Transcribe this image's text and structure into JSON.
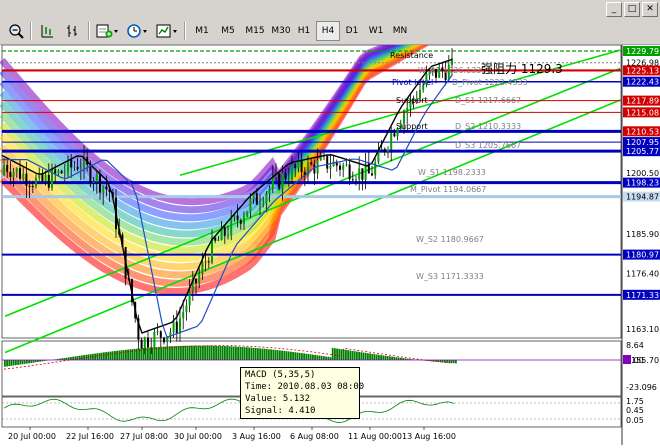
{
  "window": {
    "controls": [
      "_",
      "□",
      "✕"
    ]
  },
  "toolbar": {
    "periods": [
      "M1",
      "M5",
      "M15",
      "M30",
      "H1",
      "H4",
      "D1",
      "W1",
      "MN"
    ],
    "active_period": "H4"
  },
  "price_scale": [
    "1229.79",
    "1226.98",
    "1225.13",
    "1222.43",
    "1217.89",
    "1215.08",
    "1210.53",
    "1207.95",
    "1205.77",
    "1200.50",
    "1198.23",
    "1194.87",
    "1185.90",
    "1180.97",
    "1176.40",
    "1171.33",
    "1163.10",
    "1155.70"
  ],
  "price_tags": [
    {
      "label": "1229.79",
      "bg": "#00a000",
      "fg": "#ffffff"
    },
    {
      "label": "1225.13",
      "bg": "#d00000",
      "fg": "#ffffff"
    },
    {
      "label": "1222.43",
      "bg": "#0000c0",
      "fg": "#ffffff"
    },
    {
      "label": "1217.89",
      "bg": "#d00000",
      "fg": "#ffffff"
    },
    {
      "label": "1215.08",
      "bg": "#d00000",
      "fg": "#ffffff"
    },
    {
      "label": "1210.53",
      "bg": "#d00000",
      "fg": "#ffffff"
    },
    {
      "label": "1207.95",
      "bg": "#0000c0",
      "fg": "#ffffff"
    },
    {
      "label": "1205.77",
      "bg": "#0000c0",
      "fg": "#ffffff"
    },
    {
      "label": "1198.23",
      "bg": "#0000c0",
      "fg": "#ffffff"
    },
    {
      "label": "1194.87",
      "bg": "#c8dcf0",
      "fg": "#000000"
    },
    {
      "label": "1180.97",
      "bg": "#0000c0",
      "fg": "#ffffff"
    },
    {
      "label": "1171.33",
      "bg": "#0000c0",
      "fg": "#ffffff"
    }
  ],
  "level_labels": [
    {
      "text": "Resistance",
      "color": "#000000"
    },
    {
      "text": "W_R1 1226.1333",
      "color": "#808080"
    },
    {
      "text": "Pivot level",
      "color": "#0000a0"
    },
    {
      "text": "D_Pivot 1222.4333",
      "color": "#808080"
    },
    {
      "text": "Support",
      "color": "#000000"
    },
    {
      "text": "D_S1 1217.6667",
      "color": "#808080"
    },
    {
      "text": "Support",
      "color": "#000000"
    },
    {
      "text": "D_S2 1210.3333",
      "color": "#808080"
    },
    {
      "text": "D_S3 1205.7667",
      "color": "#808080"
    },
    {
      "text": "W_S1 1198.2333",
      "color": "#808080"
    },
    {
      "text": "M_Pivot 1194.0667",
      "color": "#808080"
    },
    {
      "text": "W_S2 1180.9667",
      "color": "#808080"
    },
    {
      "text": "W_S3 1171.3333",
      "color": "#808080"
    }
  ],
  "annotation": "强阻力 1129.3",
  "macd": {
    "scale": [
      "8.64",
      "0.00",
      "-23.096"
    ],
    "tooltip": {
      "line1": "MACD (5,35,5)",
      "line2": "Time: 2010.08.03 08:00",
      "line3": "Value: 5.132",
      "line4": "Signal: 4.410"
    }
  },
  "stoch": {
    "scale": [
      "1.75",
      "0.45",
      "0.05"
    ]
  },
  "time_axis": [
    "20 Jul 00:00",
    "22 Jul 16:00",
    "27 Jul 08:00",
    "30 Jul 00:00",
    "3 Aug 16:00",
    "6 Aug 08:00",
    "11 Aug 00:00",
    "13 Aug 16:00"
  ],
  "colors": {
    "bull_candle": "#00a000",
    "bear_candle": "#000000",
    "channel": "#00e000",
    "pivot_blue": "#0000c0",
    "resistance_red": "#d00000"
  }
}
